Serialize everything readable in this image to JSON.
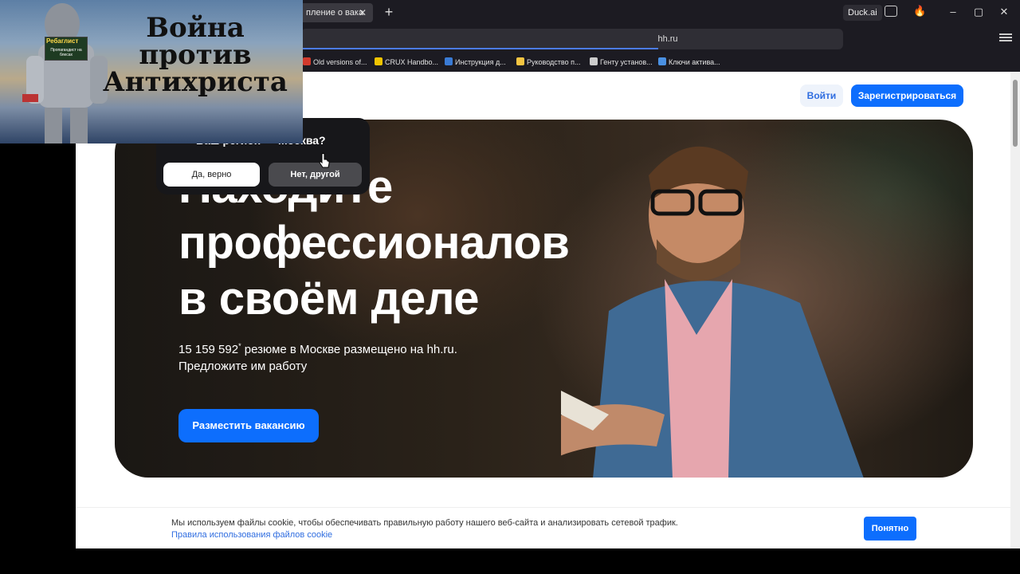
{
  "browser": {
    "tab_title": "пление о вака",
    "url": "hh.ru",
    "duck_ai": "Duck.ai",
    "bookmarks": [
      {
        "label": "Old versions of...",
        "color": "#d23a2c"
      },
      {
        "label": "CRUX Handbo...",
        "color": "#f0c400"
      },
      {
        "label": "Инструкция д...",
        "color": "#3a7bd5"
      },
      {
        "label": "Руководство п...",
        "color": "#f5c542"
      },
      {
        "label": "Генту установ...",
        "color": "#cccccc"
      },
      {
        "label": "Ключи актива...",
        "color": "#4a90e2"
      }
    ]
  },
  "header": {
    "login": "Войти",
    "register": "Зарегистрироваться"
  },
  "hero": {
    "title_lines": [
      "Находите",
      "профессионалов",
      "в своём деле"
    ],
    "count": "15 159 592",
    "count_mark": "*",
    "subtitle_rest": " резюме в Москве размещено на hh.ru.",
    "subtitle_line2": "Предложите им работу",
    "post_button": "Разместить вакансию"
  },
  "city_popup": {
    "question": "Ваш регион — Москва?",
    "yes": "Да, верно",
    "no": "Нет, другой"
  },
  "cookie": {
    "text": "Мы используем файлы cookie, чтобы обеспечивать правильную работу нашего веб-сайта и анализировать сетевой трафик.",
    "link": "Правила использования файлов cookie",
    "ok": "Понятно"
  },
  "overlay": {
    "title_lines": [
      "Война",
      "против",
      "Антихриста"
    ],
    "sign_title": "Ребаглист",
    "sign_sub": "Пропагандист на блесах"
  },
  "colors": {
    "accent": "#0d6efd",
    "link": "#2f6de0"
  }
}
